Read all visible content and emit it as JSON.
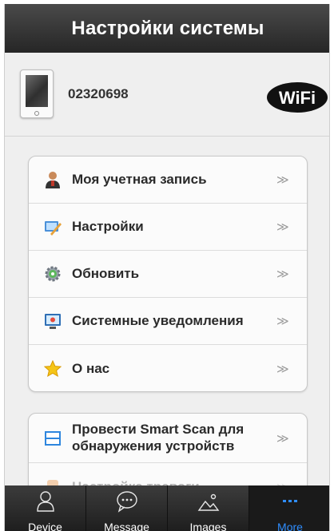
{
  "header": {
    "title": "Настройки системы"
  },
  "device": {
    "id": "02320698",
    "wifi_label": "WiFi"
  },
  "menu": {
    "items": [
      {
        "label": "Моя учетная запись",
        "arrow": "≫",
        "icon": "user-icon"
      },
      {
        "label": "Настройки",
        "arrow": "≫",
        "icon": "settings-icon"
      },
      {
        "label": "Обновить",
        "arrow": "≫",
        "icon": "update-gear-icon"
      },
      {
        "label": "Системные уведомления",
        "arrow": "≫",
        "icon": "monitor-icon"
      },
      {
        "label": "О нас",
        "arrow": "≫",
        "icon": "star-icon"
      }
    ]
  },
  "menu2": {
    "items": [
      {
        "label_line1": "Провести Smart Scan для",
        "label_line2": "обнаружения устройств",
        "arrow": "≫",
        "icon": "scan-icon"
      },
      {
        "label": "Настройка тревоги",
        "arrow": "≫",
        "icon": "alarm-icon"
      }
    ]
  },
  "tabs": [
    {
      "label": "Device",
      "icon": "person-icon"
    },
    {
      "label": "Message",
      "icon": "chat-icon"
    },
    {
      "label": "Images",
      "icon": "image-icon"
    },
    {
      "label": "More",
      "icon": "more-dots-icon",
      "active": true
    }
  ],
  "colors": {
    "accent": "#2f8dff",
    "titlebar": "#333333"
  }
}
